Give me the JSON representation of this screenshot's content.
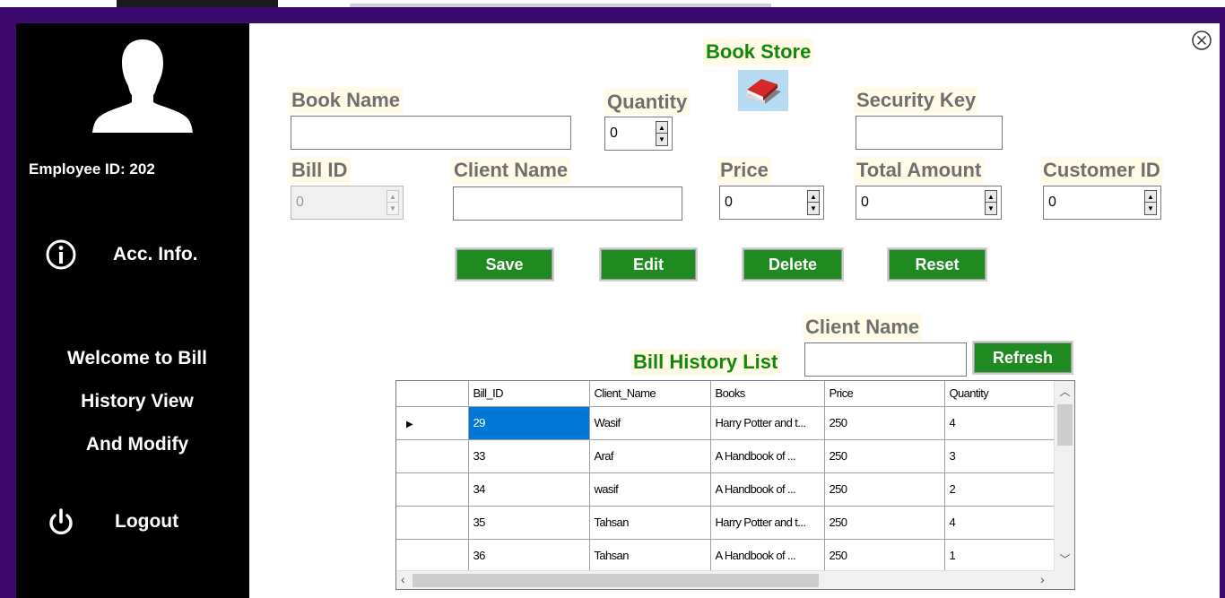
{
  "sidebar": {
    "employee_id": "Employee ID: 202",
    "acc_info": "Acc. Info.",
    "welcome_lines": [
      "Welcome to Bill",
      "History View",
      "And Modify"
    ],
    "logout": "Logout"
  },
  "form": {
    "title": "Book Store",
    "book_name_label": "Book Name",
    "book_name_value": "",
    "quantity_label": "Quantity",
    "quantity_value": "0",
    "security_key_label": "Security Key",
    "security_key_value": "",
    "bill_id_label": "Bill ID",
    "bill_id_value": "0",
    "client_name_label": "Client Name",
    "client_name_value": "",
    "price_label": "Price",
    "price_value": "0",
    "total_amount_label": "Total Amount",
    "total_amount_value": "0",
    "customer_id_label": "Customer ID",
    "customer_id_value": "0"
  },
  "actions": {
    "save": "Save",
    "edit": "Edit",
    "delete": "Delete",
    "reset": "Reset"
  },
  "history": {
    "title": "Bill History List",
    "search_label": "Client Name",
    "search_value": "",
    "refresh": "Refresh",
    "columns": [
      "Bill_ID",
      "Client_Name",
      "Books",
      "Price",
      "Quantity"
    ],
    "rows": [
      [
        "29",
        "Wasif",
        "Harry Potter and t...",
        "250",
        "4"
      ],
      [
        "33",
        "Araf",
        " A Handbook of ...",
        "250",
        "3"
      ],
      [
        "34",
        "wasif",
        " A Handbook of ...",
        "250",
        "2"
      ],
      [
        "35",
        "Tahsan",
        "Harry Potter and t...",
        "250",
        "4"
      ],
      [
        "36",
        "Tahsan",
        " A Handbook of ...",
        "250",
        "1"
      ]
    ]
  },
  "colors": {
    "frame": "#3d0a70",
    "button_green": "#1f8a1f",
    "title_green": "#138808",
    "selection": "#0078d7"
  }
}
